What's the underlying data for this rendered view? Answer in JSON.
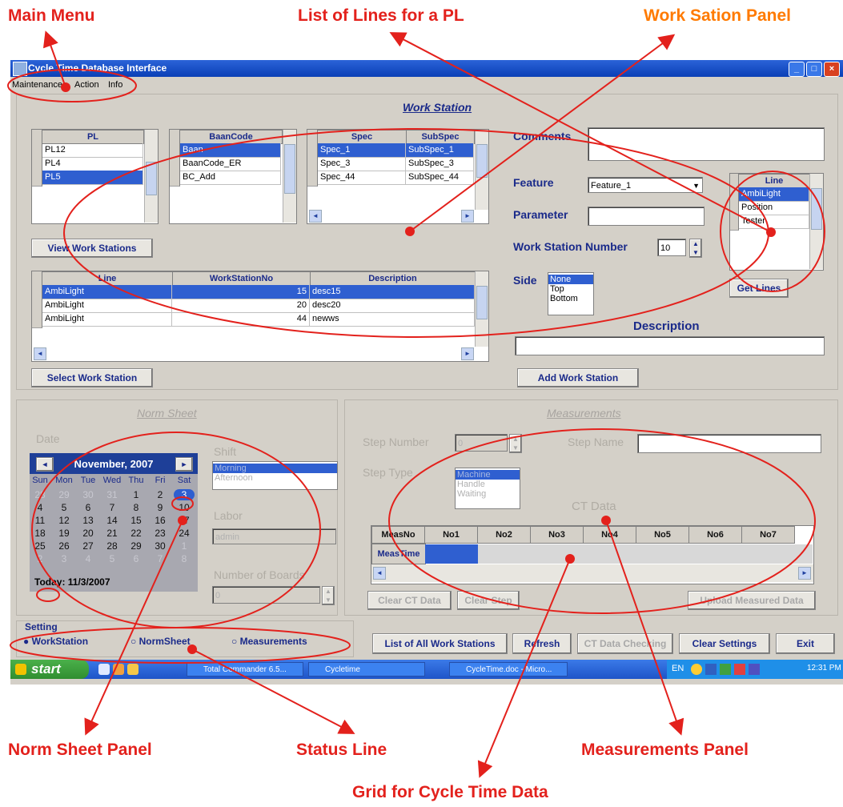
{
  "callouts": {
    "main_menu": "Main Menu",
    "list_of_lines": "List of Lines for a PL",
    "work_station_panel": "Work Sation Panel",
    "norm_sheet_panel": "Norm Sheet Panel",
    "status_line": "Status Line",
    "measurements_panel": "Measurements Panel",
    "grid_ct": "Grid for Cycle Time Data"
  },
  "window": {
    "title": "Cycle Time Database Interface"
  },
  "menu": [
    "Maintenance",
    "Action",
    "Info"
  ],
  "work_station": {
    "title": "Work Station",
    "pl_grid": {
      "header": "PL",
      "rows": [
        "PL12",
        "PL4",
        "PL5"
      ],
      "selected": 2
    },
    "baan_grid": {
      "header": "BaanCode",
      "rows": [
        "Baan",
        "BaanCode_ER",
        "BC_Add"
      ],
      "selected": 0
    },
    "spec_grid": {
      "headers": [
        "Spec",
        "SubSpec"
      ],
      "rows": [
        [
          "Spec_1",
          "SubSpec_1"
        ],
        [
          "Spec_3",
          "SubSpec_3"
        ],
        [
          "Spec_44",
          "SubSpec_44"
        ]
      ],
      "selected": 0
    },
    "view_button": "View Work Stations",
    "ws_grid": {
      "headers": [
        "Line",
        "WorkStationNo",
        "Description"
      ],
      "rows": [
        [
          "AmbiLight",
          "15",
          "desc15"
        ],
        [
          "AmbiLight",
          "20",
          "desc20"
        ],
        [
          "AmbiLight",
          "44",
          "newws"
        ]
      ],
      "selected": 0
    },
    "select_button": "Select Work Station",
    "comments_label": "Comments",
    "feature_label": "Feature",
    "feature_value": "Feature_1",
    "parameter_label": "Parameter",
    "ws_number_label": "Work Station Number",
    "ws_number_value": "10",
    "side_label": "Side",
    "side_options": [
      "None",
      "Top",
      "Bottom"
    ],
    "side_selected": 0,
    "line_grid": {
      "header": "Line",
      "rows": [
        "AmbiLight",
        "Position",
        "Tester"
      ],
      "selected": 0
    },
    "get_lines_button": "Get Lines",
    "description_label": "Description",
    "add_button": "Add Work Station"
  },
  "norm_sheet": {
    "title": "Norm Sheet",
    "date_label": "Date",
    "month": "November, 2007",
    "weekdays": [
      "Sun",
      "Mon",
      "Tue",
      "Wed",
      "Thu",
      "Fri",
      "Sat"
    ],
    "weeks": [
      [
        "28",
        "29",
        "30",
        "31",
        "1",
        "2",
        "3"
      ],
      [
        "4",
        "5",
        "6",
        "7",
        "8",
        "9",
        "10"
      ],
      [
        "11",
        "12",
        "13",
        "14",
        "15",
        "16",
        "17"
      ],
      [
        "18",
        "19",
        "20",
        "21",
        "22",
        "23",
        "24"
      ],
      [
        "25",
        "26",
        "27",
        "28",
        "29",
        "30",
        "1"
      ],
      [
        "2",
        "3",
        "4",
        "5",
        "6",
        "7",
        "8"
      ]
    ],
    "today": "Today: 11/3/2007",
    "shift_label": "Shift",
    "shift_options": [
      "Morning",
      "Afternoon"
    ],
    "labor_label": "Labor",
    "labor_value": "admin",
    "boards_label": "Number of Boards",
    "boards_value": "0"
  },
  "measurements": {
    "title": "Measurements",
    "step_number_label": "Step Number",
    "step_number_value": "0",
    "step_name_label": "Step Name",
    "step_type_label": "Step Type",
    "step_type_options": [
      "Machine",
      "Handle",
      "Waiting"
    ],
    "ct_data_label": "CT Data",
    "ct_headers": [
      "MeasNo",
      "No1",
      "No2",
      "No3",
      "No4",
      "No5",
      "No6",
      "No7"
    ],
    "ct_row_label": "MeasTime",
    "clear_ct_button": "Clear CT Data",
    "clear_step_button": "Clear Step",
    "upload_button": "Upload Measured Data"
  },
  "setting": {
    "label": "Setting",
    "options": [
      "WorkStation",
      "NormSheet",
      "Measurements"
    ],
    "selected": 0
  },
  "bottom_buttons": [
    "List of All Work Stations",
    "Refresh",
    "CT Data Checking",
    "Clear Settings",
    "Exit"
  ],
  "taskbar": {
    "start": "start",
    "items": [
      "Total Commander 6.5...",
      "Cycletime",
      "CycleTime.doc - Micro..."
    ],
    "lang": "EN",
    "clock": "12:31 PM"
  },
  "colors": {
    "annotation_red": "#e3211c",
    "annotation_orange": "#ff7a00",
    "selection": "#2f5fd0",
    "label_blue": "#1a2a8a"
  }
}
